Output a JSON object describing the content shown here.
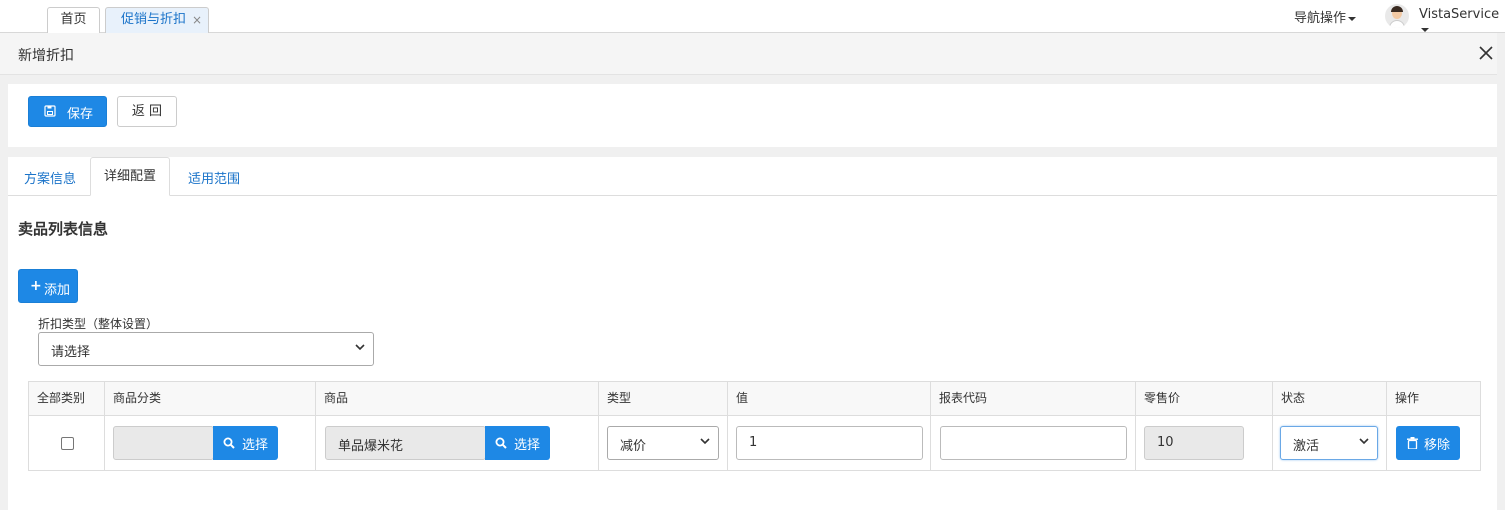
{
  "top_tabs": [
    {
      "label": "首页"
    },
    {
      "label": "促销与折扣",
      "close": "×"
    }
  ],
  "nav_ops": "导航操作",
  "user": "VistaService",
  "panel": {
    "title": "新增折扣"
  },
  "toolbar": {
    "save_label": "保存",
    "back_label": "返 回"
  },
  "page_tabs": [
    {
      "label": "方案信息"
    },
    {
      "label": "详细配置",
      "active": true
    },
    {
      "label": "适用范围"
    }
  ],
  "section": {
    "title": "卖品列表信息",
    "add_label": "添加"
  },
  "discount_type": {
    "label": "折扣类型（整体设置）",
    "value": "请选择"
  },
  "table": {
    "headers": [
      "全部类别",
      "商品分类",
      "商品",
      "类型",
      "值",
      "报表代码",
      "零售价",
      "状态",
      "操作"
    ],
    "row": {
      "category": "",
      "category_btn": "选择",
      "product": "单品爆米花",
      "product_btn": "选择",
      "type": "减价",
      "value": "1",
      "report_code": "",
      "retail_price": "10",
      "status": "激活",
      "remove_label": "移除"
    }
  },
  "colors": {
    "primary": "#1e88e5",
    "link": "#1a73c9"
  }
}
